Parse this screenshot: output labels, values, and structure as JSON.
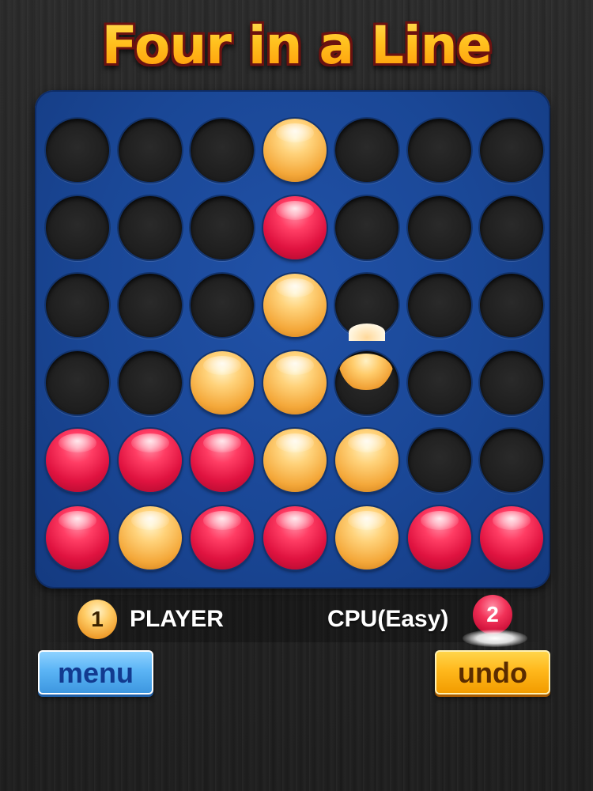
{
  "title": "Four in a Line",
  "board": {
    "columns": 7,
    "rows": 6,
    "grid": [
      [
        "empty",
        "empty",
        "empty",
        "yellow",
        "empty",
        "empty",
        "empty"
      ],
      [
        "empty",
        "empty",
        "empty",
        "red",
        "empty",
        "empty",
        "empty"
      ],
      [
        "empty",
        "empty",
        "empty",
        "yellow",
        "empty",
        "empty",
        "empty"
      ],
      [
        "empty",
        "empty",
        "yellow",
        "yellow",
        "empty",
        "empty",
        "empty"
      ],
      [
        "red",
        "red",
        "red",
        "yellow",
        "yellow",
        "empty",
        "empty"
      ],
      [
        "red",
        "yellow",
        "red",
        "red",
        "yellow",
        "red",
        "red"
      ]
    ],
    "falling_disc": {
      "color": "yellow",
      "column": 5
    },
    "colors": {
      "board": "#1a4796",
      "red_disc": "#e01340",
      "yellow_disc": "#f4a83a"
    }
  },
  "players": {
    "player1": {
      "badge": "1",
      "name": "PLAYER",
      "disc": "yellow"
    },
    "player2": {
      "badge": "2",
      "name": "CPU(Easy)",
      "disc": "red",
      "current_turn": true
    }
  },
  "buttons": {
    "menu_label": "menu",
    "undo_label": "undo"
  }
}
